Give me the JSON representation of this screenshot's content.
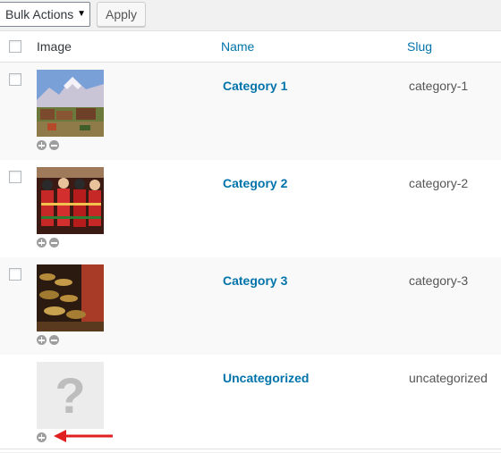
{
  "toolbar": {
    "bulk_actions_value": "Bulk Actions",
    "apply_label": "Apply"
  },
  "columns": {
    "image": "Image",
    "name": "Name",
    "slug": "Slug"
  },
  "rows": [
    {
      "name": "Category 1",
      "slug": "category-1",
      "image": "mountain-village-thumbnail",
      "actions": [
        "add-image",
        "remove-image"
      ]
    },
    {
      "name": "Category 2",
      "slug": "category-2",
      "image": "dolls-thumbnail",
      "actions": [
        "add-image",
        "remove-image"
      ]
    },
    {
      "name": "Category 3",
      "slug": "category-3",
      "image": "singing-bowls-thumbnail",
      "actions": [
        "add-image",
        "remove-image"
      ]
    },
    {
      "name": "Uncategorized",
      "slug": "uncategorized",
      "image": "placeholder-question-mark",
      "placeholder_glyph": "?",
      "actions": [
        "add-image"
      ]
    }
  ],
  "colors": {
    "link": "#0073aa",
    "annotation_arrow": "#e02020",
    "row_alt": "#f9f9f9"
  }
}
